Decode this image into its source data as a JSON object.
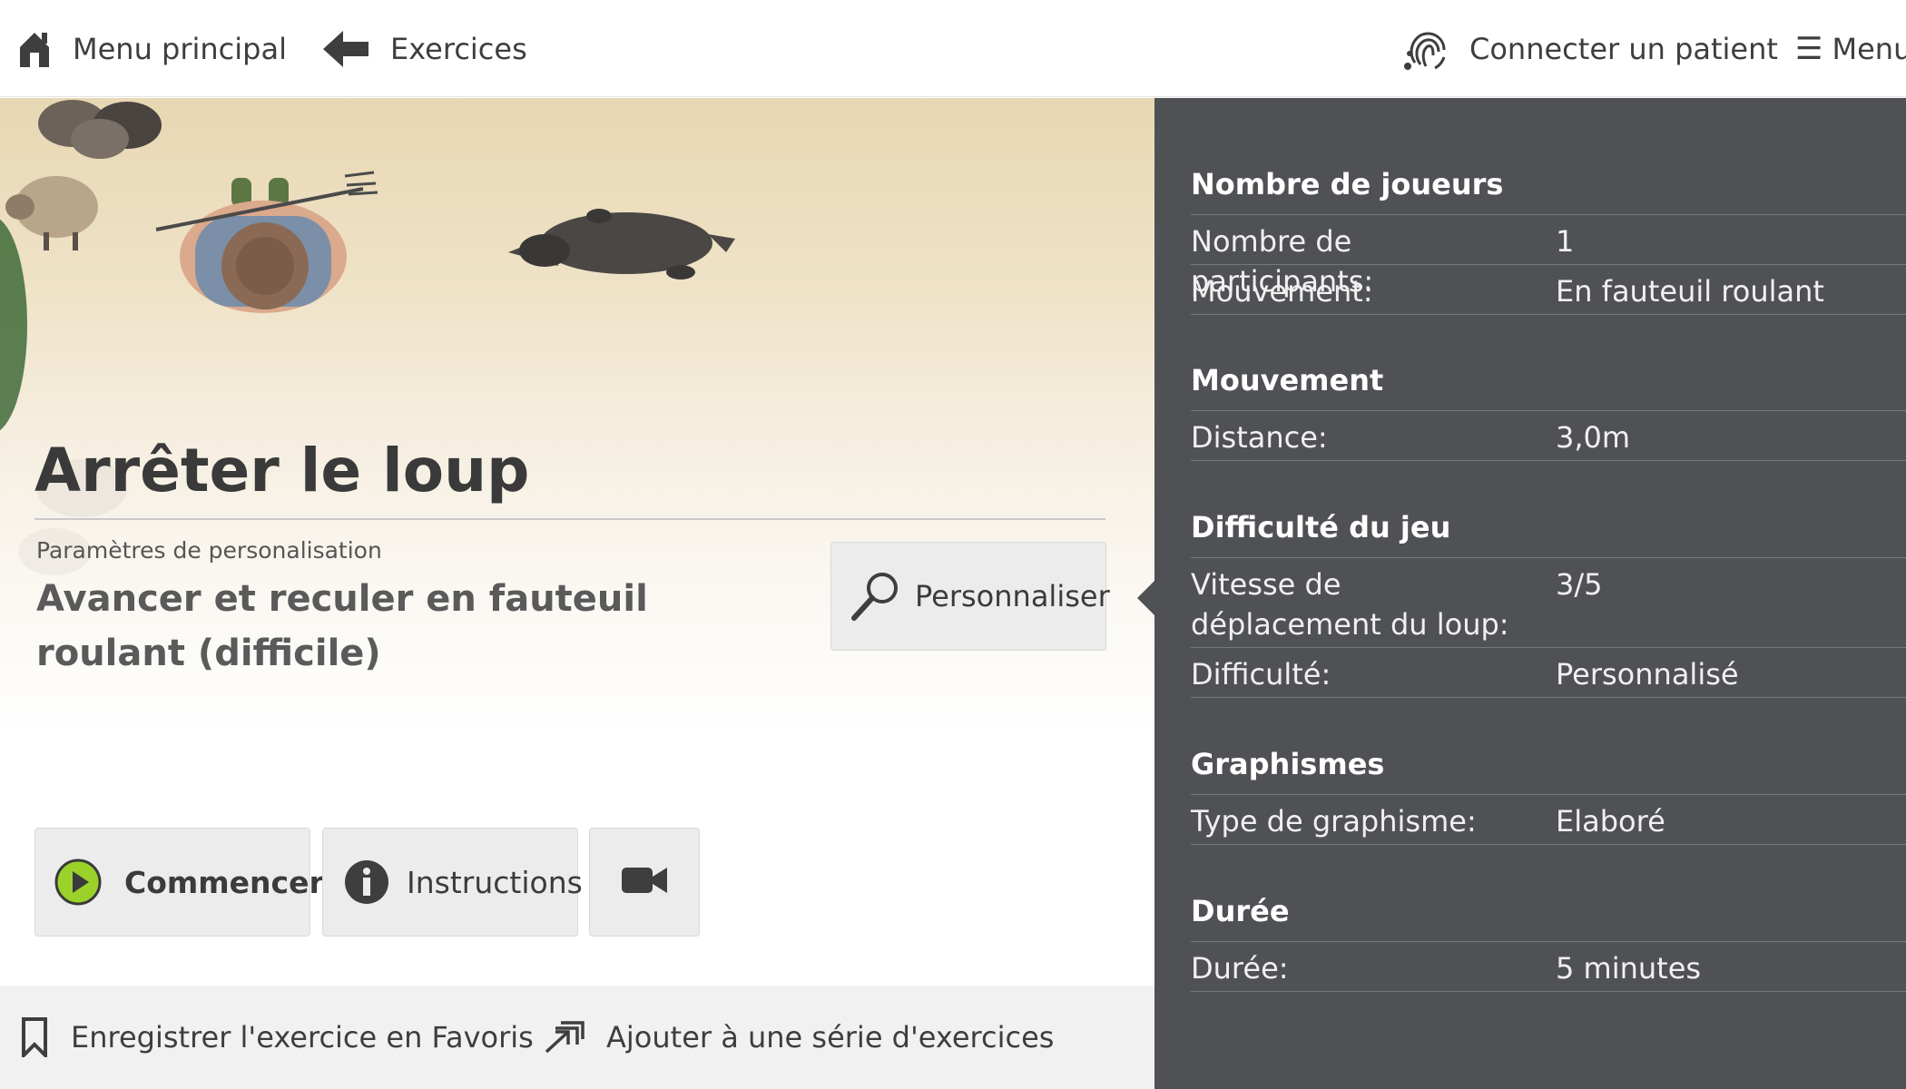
{
  "topbar": {
    "home_label": "Menu principal",
    "back_label": "Exercices",
    "connect_label": "Connecter un patient",
    "menu_glyph": "☰",
    "menu_label": "Menu",
    "icons": [
      "home-icon",
      "arrow-left-icon",
      "fingerprint-icon",
      "hamburger-icon"
    ]
  },
  "exercise": {
    "title": "Arrêter le loup",
    "settings_caption": "Paramètres de personalisation",
    "config_name": "Avancer et reculer en fauteuil roulant (difficile)",
    "personalize_label": "Personnaliser"
  },
  "actions": {
    "start_label": "Commencer",
    "instructions_label": "Instructions",
    "video_icon": "video-camera-icon"
  },
  "footer": {
    "favorite_label": "Enregistrer l'exercice en Favoris",
    "add_series_label": "Ajouter à une série d'exercices"
  },
  "panel": {
    "sections": [
      {
        "title": "Nombre de joueurs",
        "rows": [
          {
            "label": "Nombre de participants:",
            "value": "1"
          },
          {
            "label": "Mouvement:",
            "value": "En fauteuil roulant"
          }
        ]
      },
      {
        "title": "Mouvement",
        "rows": [
          {
            "label": "Distance:",
            "value": "3,0m"
          }
        ]
      },
      {
        "title": "Difficulté du jeu",
        "rows": [
          {
            "label": "Vitesse de déplacement du loup:",
            "value": "3/5"
          },
          {
            "label": "Difficulté:",
            "value": "Personnalisé"
          }
        ]
      },
      {
        "title": "Graphismes",
        "rows": [
          {
            "label": "Type de graphisme:",
            "value": "Elaboré"
          }
        ]
      },
      {
        "title": "Durée",
        "rows": [
          {
            "label": "Durée:",
            "value": "5 minutes"
          }
        ]
      }
    ]
  },
  "colors": {
    "panel_bg": "#4f5155",
    "button_bg": "#ececec",
    "play_green": "#9bd22a",
    "text_dark": "#3b3b3b"
  }
}
